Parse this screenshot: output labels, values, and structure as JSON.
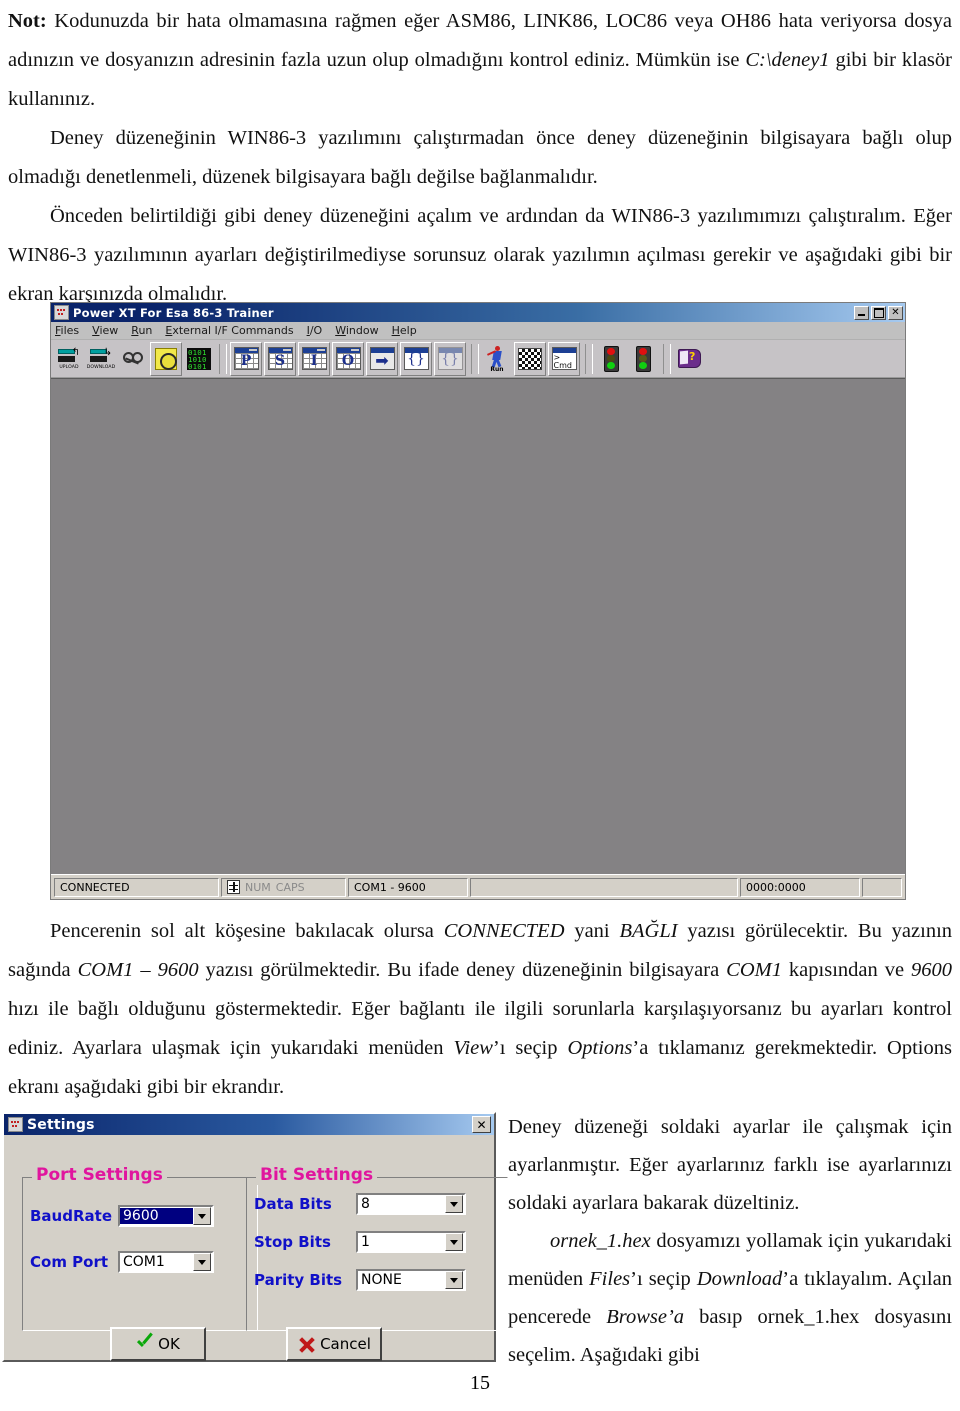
{
  "document": {
    "paragraphs": [
      {
        "id": "p1",
        "runs": [
          {
            "text": "Not:",
            "style": "bold"
          },
          {
            "text": " Kodunuzda bir hata olmamasına rağmen eğer ASM86, LINK86, LOC86 veya OH86 hata veriyorsa dosya adınızın ve dosyanızın adresinin fazla uzun olup olmadığını kontrol ediniz. Mümkün ise ",
            "style": "normal"
          },
          {
            "text": "C:\\deney1",
            "style": "italic"
          },
          {
            "text": " gibi bir klasör kullanınız.",
            "style": "normal"
          }
        ]
      },
      {
        "id": "p2",
        "runs": [
          {
            "text": "Deney düzeneğinin WIN86-3 yazılımını çalıştırmadan önce deney düzeneğinin bilgisayara bağlı olup olmadığı denetlenmeli, düzenek bilgisayara bağlı değilse bağlanmalıdır.",
            "style": "normal"
          }
        ]
      },
      {
        "id": "p3",
        "runs": [
          {
            "text": "Önceden belirtildiği gibi deney düzeneğini açalım ve ardından da WIN86-3 yazılımımızı çalıştıralım. Eğer WIN86-3 yazılımının ayarları değiştirilmediyse sorunsuz olarak yazılımın açılması gerekir ve aşağıdaki gibi bir ekran karşınızda olmalıdır.",
            "style": "normal"
          }
        ]
      },
      {
        "id": "p4",
        "runs": [
          {
            "text": "Pencerenin sol alt köşesine bakılacak olursa ",
            "style": "normal"
          },
          {
            "text": "CONNECTED",
            "style": "italic"
          },
          {
            "text": " yani ",
            "style": "normal"
          },
          {
            "text": "BAĞLI",
            "style": "italic"
          },
          {
            "text": " yazısı görülecektir. Bu yazının sağında ",
            "style": "normal"
          },
          {
            "text": "COM1 – 9600",
            "style": "italic"
          },
          {
            "text": " yazısı görülmektedir. Bu ifade deney düzeneğinin bilgisayara ",
            "style": "normal"
          },
          {
            "text": "COM1",
            "style": "italic"
          },
          {
            "text": " kapısından ve ",
            "style": "normal"
          },
          {
            "text": "9600",
            "style": "italic"
          },
          {
            "text": " hızı ile bağlı olduğunu göstermektedir. Eğer bağlantı ile ilgili sorunlarla karşılaşıyorsanız bu ayarları kontrol ediniz. Ayarlara ulaşmak için yukarıdaki menüden ",
            "style": "normal"
          },
          {
            "text": "View",
            "style": "italic"
          },
          {
            "text": "’ı seçip ",
            "style": "normal"
          },
          {
            "text": "Options",
            "style": "italic"
          },
          {
            "text": "’a tıklamanız gerekmektedir. Options ekranı aşağıdaki gibi bir ekrandır.",
            "style": "normal"
          }
        ]
      },
      {
        "id": "p5",
        "runs": [
          {
            "text": "Deney düzeneği soldaki ayarlar ile çalışmak için ayarlanmıştır. Eğer ayarlarınız farklı ise ayarlarınızı soldaki ayarlara bakarak düzeltiniz.",
            "style": "normal"
          }
        ]
      },
      {
        "id": "p6",
        "runs": [
          {
            "text": "ornek_1.hex",
            "style": "italic"
          },
          {
            "text": " dosyamızı yollamak için yukarıdaki menüden ",
            "style": "normal"
          },
          {
            "text": "Files",
            "style": "italic"
          },
          {
            "text": "’ı seçip ",
            "style": "normal"
          },
          {
            "text": "Download",
            "style": "italic"
          },
          {
            "text": "’a tıklayalım. Açılan pencerede ",
            "style": "normal"
          },
          {
            "text": "Browse’a",
            "style": "italic"
          },
          {
            "text": " basıp ornek_1.hex dosyasını seçelim. Aşağıdaki gibi",
            "style": "normal"
          }
        ]
      }
    ],
    "page_number": "15"
  },
  "app_window": {
    "title": "Power XT For Esa 86-3 Trainer",
    "title_icon": "app-dots-icon",
    "window_buttons": [
      {
        "name": "minimize",
        "glyph": "_"
      },
      {
        "name": "restore",
        "glyph": "❐"
      },
      {
        "name": "close",
        "glyph": "✕"
      }
    ],
    "menu": [
      {
        "label": "Files",
        "accel": "F"
      },
      {
        "label": "View",
        "accel": "V"
      },
      {
        "label": "Run",
        "accel": "R"
      },
      {
        "label": "External I/F Commands",
        "accel": "E"
      },
      {
        "label": "I/O",
        "accel": "I"
      },
      {
        "label": "Window",
        "accel": "W"
      },
      {
        "label": "Help",
        "accel": "H"
      }
    ],
    "toolbar": [
      {
        "name": "upload-icon",
        "label": "UPLOAD",
        "kind": "ud"
      },
      {
        "name": "download-icon",
        "label": "DOWNLOAD",
        "kind": "ud"
      },
      {
        "name": "probe-icon",
        "label": "",
        "kind": "probe"
      },
      {
        "name": "chip-icon",
        "label": "",
        "kind": "chip"
      },
      {
        "name": "binary-icon",
        "label": "",
        "kind": "bin",
        "text": "0101\n1010\n0101"
      },
      {
        "name": "port-window-icon",
        "label": "",
        "kind": "winl",
        "letter": "P"
      },
      {
        "name": "stack-window-icon",
        "label": "",
        "kind": "winl",
        "letter": "S"
      },
      {
        "name": "instruction-window-icon",
        "label": "",
        "kind": "winl",
        "letter": "I"
      },
      {
        "name": "output-window-icon",
        "label": "",
        "kind": "winl",
        "letter": "O"
      },
      {
        "name": "step-arrow-icon",
        "label": "",
        "kind": "arrw"
      },
      {
        "name": "bracket-icon",
        "label": "",
        "kind": "brkt",
        "letter": "{}"
      },
      {
        "name": "bracket-dim-icon",
        "label": "",
        "kind": "brkt-dim",
        "letter": "{}"
      },
      {
        "name": "run-icon",
        "label": "Run",
        "kind": "runm"
      },
      {
        "name": "checkerboard-icon",
        "label": "",
        "kind": "chk"
      },
      {
        "name": "command-icon",
        "label": "",
        "kind": "cmd",
        "text": ">\nCmd"
      },
      {
        "name": "traffic-light-go-icon",
        "label": "",
        "kind": "tl-go"
      },
      {
        "name": "traffic-light-stop-icon",
        "label": "",
        "kind": "tl-stop"
      },
      {
        "name": "help-book-icon",
        "label": "",
        "kind": "book"
      }
    ],
    "statusbar": {
      "connection": "CONNECTED",
      "keys_icon": "keyboard-icon",
      "num": "NUM",
      "caps": "CAPS",
      "com": "COM1 - 9600",
      "address": "0000:0000"
    }
  },
  "settings_dialog": {
    "title": "Settings",
    "title_icon": "app-dots-icon",
    "close_label": "✕",
    "groups": {
      "port": {
        "title": "Port Settings",
        "fields": [
          {
            "name": "baudrate",
            "label": "BaudRate",
            "value": "9600",
            "selected": true
          },
          {
            "name": "com-port",
            "label": "Com Port",
            "value": "COM1",
            "selected": false
          }
        ]
      },
      "bit": {
        "title": "Bit Settings",
        "fields": [
          {
            "name": "data-bits",
            "label": "Data Bits",
            "value": "8",
            "selected": false
          },
          {
            "name": "stop-bits",
            "label": "Stop Bits",
            "value": "1",
            "selected": false
          },
          {
            "name": "parity-bits",
            "label": "Parity Bits",
            "value": "NONE",
            "selected": false
          }
        ]
      }
    },
    "buttons": {
      "ok": "OK",
      "cancel": "Cancel"
    }
  },
  "colors": {
    "title_bar_start": "#0a246a",
    "title_bar_end": "#a6caf0",
    "dialog_face": "#d4d0c8",
    "group_title": "#e0159e",
    "field_label": "#1010c8",
    "client_area": "#848284",
    "selection": "#000080"
  }
}
